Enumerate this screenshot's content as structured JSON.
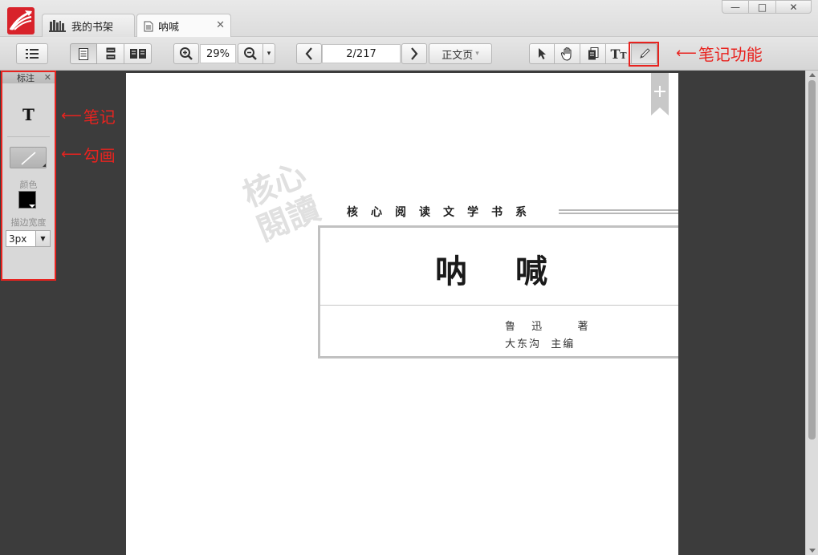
{
  "window": {
    "tabs": [
      {
        "label": "我的书架",
        "icon": "bookshelf-icon"
      },
      {
        "label": "呐喊",
        "icon": "document-icon",
        "active": true
      }
    ],
    "controls": {
      "minimize": "—",
      "maximize": "□",
      "close": "✕"
    }
  },
  "toolbar": {
    "zoom_value": "29%",
    "page_value": "2/217",
    "page_type": "正文页",
    "tools": [
      "select-tool",
      "hand-tool",
      "page-tool",
      "text-size-tool",
      "pen-tool"
    ]
  },
  "annotations": {
    "note_feature": "笔记功能",
    "note": "笔记",
    "draw": "勾画"
  },
  "panel": {
    "title": "标注",
    "color_label": "颜色",
    "color_value": "#000000",
    "stroke_label": "描边宽度",
    "stroke_value": "3px"
  },
  "page": {
    "series": "核心阅读文学书系",
    "title": "呐喊",
    "author": "鲁 迅   著",
    "editor": "大东沟  主编",
    "watermark": "核心閱讀"
  },
  "colors": {
    "accent_red": "#e8231f",
    "brand_red": "#d8222a"
  }
}
